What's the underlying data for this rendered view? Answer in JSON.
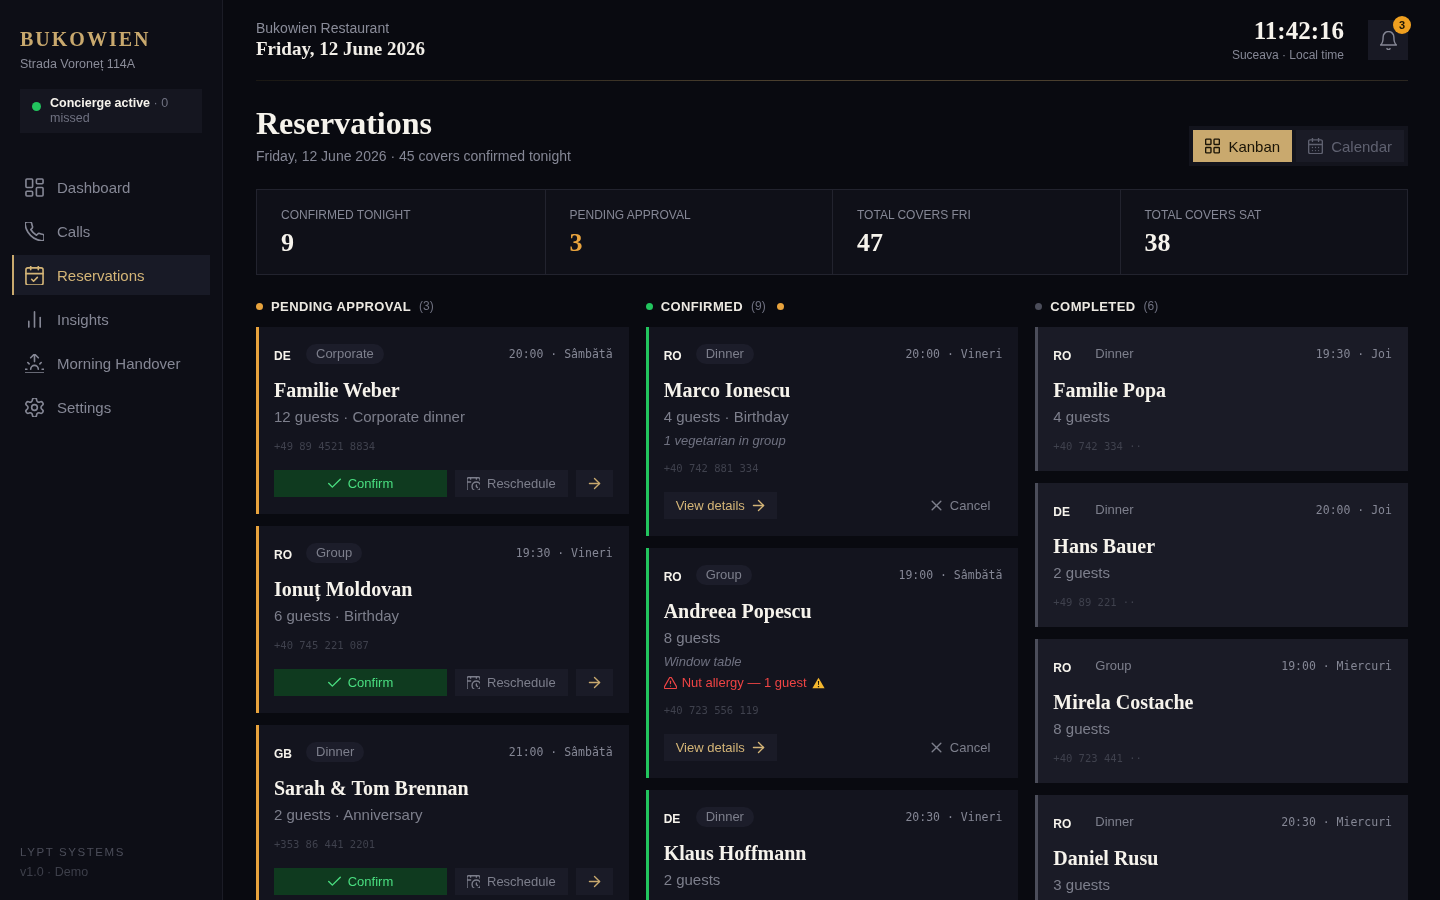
{
  "sidebar": {
    "brand": "BUKOWIEN",
    "address": "Strada Voroneț 114A",
    "concierge": {
      "online": true,
      "text": "**Concierge active** · 0 missed"
    },
    "nav": [
      {
        "label": "Dashboard",
        "selected": false
      },
      {
        "label": "Calls",
        "selected": false
      },
      {
        "label": "Reservations",
        "selected": true
      },
      {
        "label": "Insights",
        "selected": false
      },
      {
        "label": "Morning Handover",
        "selected": false
      },
      {
        "label": "Settings",
        "selected": false
      }
    ],
    "footer": {
      "company": "LYPT SYSTEMS",
      "version": "v1.0 · Demo"
    }
  },
  "header": {
    "restaurant": "Bukowien Restaurant",
    "date": "Friday, 12 June 2026",
    "clock": "11:42:16",
    "clock_caption": "Suceava · Local time",
    "notifications": "3"
  },
  "page": {
    "title": "Reservations",
    "subtitle": "Friday, 12 June 2026 · 45 covers confirmed tonight"
  },
  "view_toggle": [
    {
      "label": "Kanban",
      "selected": true
    },
    {
      "label": "Calendar",
      "selected": false
    }
  ],
  "stats": [
    {
      "label": "CONFIRMED TONIGHT",
      "value": "9",
      "accent": false
    },
    {
      "label": "PENDING APPROVAL",
      "value": "3",
      "accent": true
    },
    {
      "label": "TOTAL COVERS FRI",
      "value": "47",
      "accent": false
    },
    {
      "label": "TOTAL COVERS SAT",
      "value": "38",
      "accent": false
    }
  ],
  "columns": [
    {
      "kind": "pending",
      "title": "PENDING APPROVAL",
      "count": "(3)",
      "color": "#e8a33d",
      "alert": false,
      "cards": [
        {
          "code": "DE",
          "tag": "Corporate",
          "when": "20:00 · Sâmbătă",
          "name": "Familie Weber",
          "details": "12 guests · Corporate dinner",
          "phone": "+49 89 4521 8834",
          "actions": [
            {
              "kind": "confirm",
              "label": "Confirm"
            },
            {
              "kind": "reschedule",
              "label": "Reschedule"
            },
            {
              "kind": "open"
            }
          ]
        },
        {
          "code": "RO",
          "tag": "Group",
          "when": "19:30 · Vineri",
          "name": "Ionuț Moldovan",
          "details": "6 guests · Birthday",
          "phone": "+40 745 221 087",
          "actions": [
            {
              "kind": "confirm",
              "label": "Confirm"
            },
            {
              "kind": "reschedule",
              "label": "Reschedule"
            },
            {
              "kind": "open"
            }
          ]
        },
        {
          "code": "GB",
          "tag": "Dinner",
          "when": "21:00 · Sâmbătă",
          "name": "Sarah & Tom Brennan",
          "details": "2 guests · Anniversary",
          "phone": "+353 86 441 2201",
          "actions": [
            {
              "kind": "confirm",
              "label": "Confirm"
            },
            {
              "kind": "reschedule",
              "label": "Reschedule"
            },
            {
              "kind": "open"
            }
          ]
        }
      ]
    },
    {
      "kind": "confirmed",
      "title": "CONFIRMED",
      "count": "(9)",
      "color": "#22c55e",
      "alert": true,
      "cards": [
        {
          "code": "RO",
          "tag": "Dinner",
          "when": "20:00 · Vineri",
          "name": "Marco Ionescu",
          "details": "4 guests · Birthday",
          "notes": [
            {
              "kind": "note",
              "text": "1 vegetarian in group"
            }
          ],
          "phone": "+40 742 881 334",
          "actions": [
            {
              "kind": "view",
              "label": "View details"
            },
            {
              "kind": "cancel",
              "label": "Cancel"
            }
          ]
        },
        {
          "code": "RO",
          "tag": "Group",
          "when": "19:00 · Sâmbătă",
          "name": "Andreea Popescu",
          "details": "8 guests",
          "notes": [
            {
              "kind": "note",
              "text": "Window table"
            },
            {
              "kind": "allergy",
              "text": "Nut allergy — 1 guest"
            }
          ],
          "phone": "+40 723 556 119",
          "actions": [
            {
              "kind": "view",
              "label": "View details"
            },
            {
              "kind": "cancel",
              "label": "Cancel"
            }
          ]
        },
        {
          "code": "DE",
          "tag": "Dinner",
          "when": "20:30 · Vineri",
          "name": "Klaus Hoffmann",
          "details": "2 guests"
        }
      ]
    },
    {
      "kind": "completed",
      "title": "COMPLETED",
      "count": "(6)",
      "color": "#4b4d5a",
      "alert": false,
      "cards": [
        {
          "code": "RO",
          "tag": "Dinner",
          "when": "19:30 · Joi",
          "name": "Familie Popa",
          "details": "4 guests",
          "phone": "+40 742 334 ··"
        },
        {
          "code": "DE",
          "tag": "Dinner",
          "when": "20:00 · Joi",
          "name": "Hans Bauer",
          "details": "2 guests",
          "phone": "+49 89 221 ··"
        },
        {
          "code": "RO",
          "tag": "Group",
          "when": "19:00 · Miercuri",
          "name": "Mirela Costache",
          "details": "8 guests",
          "phone": "+40 723 441 ··"
        },
        {
          "code": "RO",
          "tag": "Dinner",
          "when": "20:30 · Miercuri",
          "name": "Daniel Rusu",
          "details": "3 guests"
        }
      ]
    }
  ]
}
